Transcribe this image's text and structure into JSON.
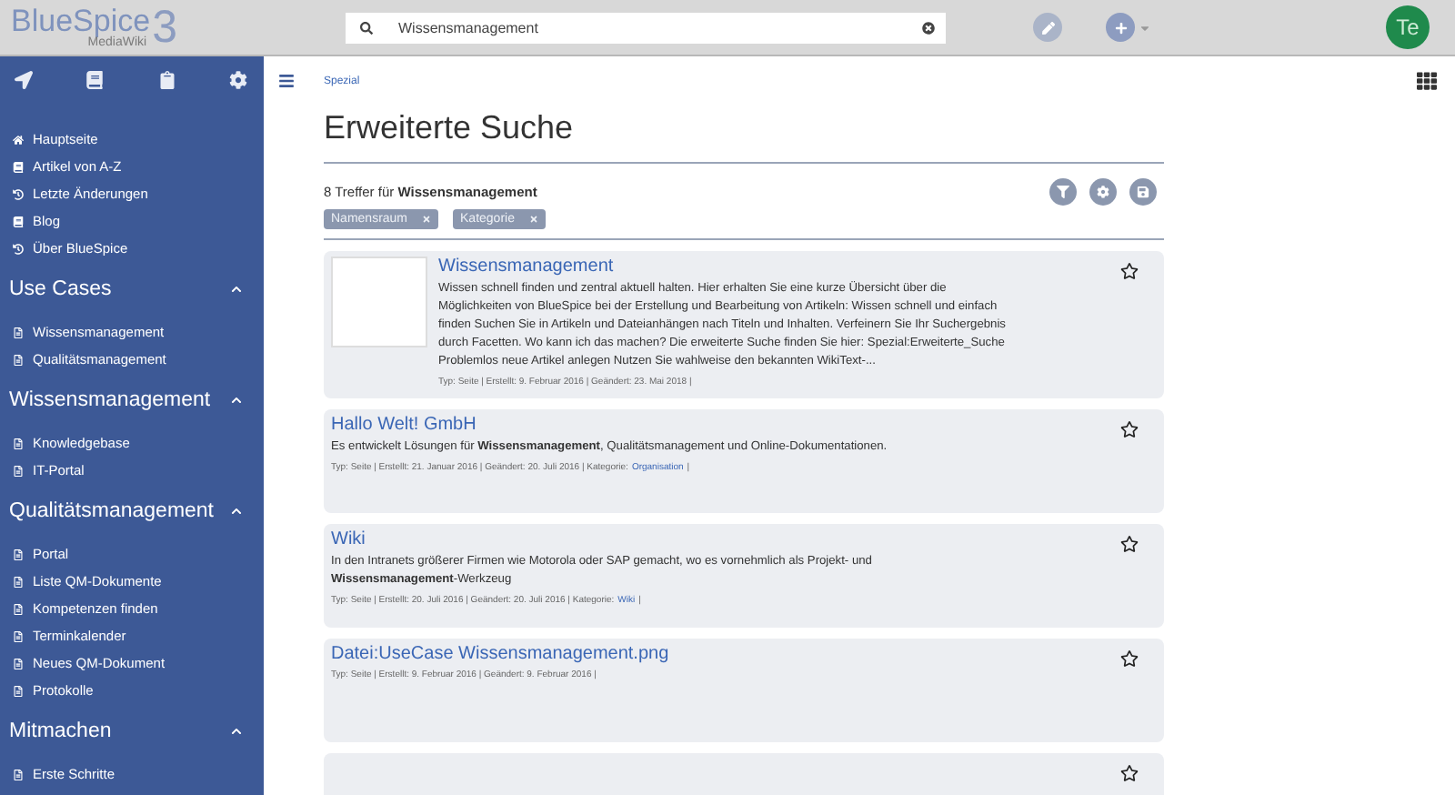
{
  "logo": {
    "name": "BlueSpice",
    "sub": "MediaWiki",
    "version": "3"
  },
  "search": {
    "value": "Wissensmanagement"
  },
  "user": {
    "initials": "Te"
  },
  "sidebar": {
    "top_links": [
      "Hauptseite",
      "Artikel von A-Z",
      "Letzte Änderungen",
      "Blog",
      "Über BlueSpice"
    ],
    "sections": [
      {
        "title": "Use Cases",
        "expanded": true,
        "items": [
          "Wissensmanagement",
          "Qualitätsmanagement"
        ]
      },
      {
        "title": "Wissensmanagement",
        "expanded": true,
        "items": [
          "Knowledgebase",
          "IT-Portal"
        ]
      },
      {
        "title": "Qualitätsmanagement",
        "expanded": true,
        "items": [
          "Portal",
          "Liste QM-Dokumente",
          "Kompetenzen finden",
          "Terminkalender",
          "Neues QM-Dokument",
          "Protokolle"
        ]
      },
      {
        "title": "Mitmachen",
        "expanded": true,
        "items": [
          "Erste Schritte"
        ]
      }
    ]
  },
  "breadcrumb": "Spezial",
  "page_title": "Erweiterte Suche",
  "hit_summary": "8 Treffer für **Wissensmanagement**",
  "filters": [
    "Namensraum",
    "Kategorie"
  ],
  "results": [
    {
      "title": "Wissensmanagement",
      "thumbnail": true,
      "snippet": "Wissen schnell finden und zentral aktuell halten. Hier erhalten Sie eine kurze Übersicht über die Möglichkeiten von BlueSpice bei der Erstellung und Bearbeitung von Artikeln: Wissen schnell und einfach finden Suchen Sie in Artikeln und Dateianhängen nach Titeln und Inhalten. Verfeinern Sie Ihr Suchergebnis durch Facetten. Wo kann ich das machen? Die erweiterte Suche finden Sie hier: Spezial:Erweiterte_Suche Problemlos neue Artikel anlegen Nutzen Sie wahlweise den bekannten WikiText-...",
      "meta": [
        {
          "kind": "plain",
          "text": "Typ: Seite | Erstellt: 9. Februar 2016 | Geändert: 23. Mai 2018 |"
        }
      ]
    },
    {
      "title": "Hallo Welt! GmbH",
      "thumbnail": false,
      "snippet": "Es entwickelt Lösungen für **Wissensmanagement**, Qualitätsmanagement und Online-Dokumentationen.",
      "meta": [
        {
          "kind": "plain",
          "text": "Typ: Seite | Erstellt: 21. Januar 2016 | Geändert: 20. Juli 2016 | Kategorie:"
        },
        {
          "kind": "link",
          "text": "Organisation"
        },
        {
          "kind": "plain",
          "text": "|"
        }
      ]
    },
    {
      "title": "Wiki",
      "thumbnail": false,
      "snippet": "In den Intranets größerer Firmen wie Motorola oder SAP gemacht, wo es vornehmlich als Projekt- und **Wissensmanagement**-Werkzeug",
      "meta": [
        {
          "kind": "plain",
          "text": "Typ: Seite | Erstellt: 20. Juli 2016 | Geändert: 20. Juli 2016 | Kategorie:"
        },
        {
          "kind": "link",
          "text": "Wiki"
        },
        {
          "kind": "plain",
          "text": "|"
        }
      ]
    },
    {
      "title": "Datei:UseCase Wissensmanagement.png",
      "thumbnail": false,
      "meta": [
        {
          "kind": "plain",
          "text": "Typ: Seite | Erstellt: 9. Februar 2016 | Geändert: 9. Februar 2016 |"
        }
      ]
    },
    {
      "thumbnail": false
    }
  ]
}
